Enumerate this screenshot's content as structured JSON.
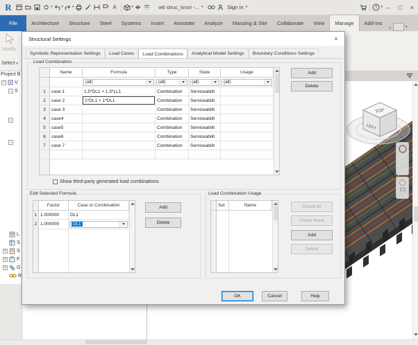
{
  "titlebar": {
    "document_title": "w6 struc_knsri -...",
    "sign_in_label": "Sign In"
  },
  "icons": {
    "minimize": "–",
    "maximize": "□",
    "close": "×",
    "overflow": "»",
    "caret": "▾",
    "expand_plus": "+",
    "collapse_minus": "−",
    "help_mark": "?"
  },
  "ribbon": {
    "tabs": [
      "File",
      "Architecture",
      "Structure",
      "Steel",
      "Systems",
      "Insert",
      "Annotate",
      "Analyze",
      "Massing & Site",
      "Collaborate",
      "View",
      "Manage",
      "Add-Ins"
    ],
    "active_tab": "Manage",
    "modify_label": "Modify",
    "select_label": "Select"
  },
  "project_browser": {
    "title": "Project B",
    "items": [
      {
        "label": "V"
      },
      {
        "label": "S"
      },
      {
        "label": ""
      },
      {
        "label": ""
      },
      {
        "label": "L"
      },
      {
        "label": "S"
      },
      {
        "label": "S"
      },
      {
        "label": "F"
      },
      {
        "label": "G"
      },
      {
        "label": "R"
      }
    ]
  },
  "view": {
    "cube_top": "TOP",
    "cube_left": "LEFT"
  },
  "dialog": {
    "title": "Structural Settings",
    "tabs": [
      "Symbolic Representation Settings",
      "Load Cases",
      "Load Combinations",
      "Analytical Model Settings",
      "Boundary Conditions Settings"
    ],
    "active_tab": "Load Combinations",
    "load_combination": {
      "group_label": "Load Combination",
      "columns": [
        "Name",
        "Formula",
        "Type",
        "State",
        "Usage"
      ],
      "filter_value": "(all)",
      "rows": [
        {
          "num": "1",
          "name": "case 1",
          "formula": "1.5*DL1 + 1.5*LL1",
          "type": "Combination",
          "state": "Serviceabilit",
          "usage": ""
        },
        {
          "num": "2",
          "name": "case 2",
          "formula": "1*DL1 + 1*DL1",
          "type": "Combination",
          "state": "Serviceabilit",
          "usage": ""
        },
        {
          "num": "3",
          "name": "case 3",
          "formula": "",
          "type": "Combination",
          "state": "Serviceabilit",
          "usage": ""
        },
        {
          "num": "4",
          "name": "case4",
          "formula": "",
          "type": "Combination",
          "state": "Serviceabilit",
          "usage": ""
        },
        {
          "num": "5",
          "name": "case5",
          "formula": "",
          "type": "Combination",
          "state": "Serviceabilit",
          "usage": ""
        },
        {
          "num": "6",
          "name": "case6",
          "formula": "",
          "type": "Combination",
          "state": "Serviceabilit",
          "usage": ""
        },
        {
          "num": "7",
          "name": "case 7",
          "formula": "",
          "type": "Combination",
          "state": "Serviceabilit",
          "usage": ""
        }
      ],
      "add_label": "Add",
      "delete_label": "Delete",
      "checkbox_label": "Show third-party generated load combinations"
    },
    "edit_formula": {
      "group_label": "Edit Selected Formula",
      "columns": [
        "Factor",
        "Case or Combination"
      ],
      "rows": [
        {
          "num": "1",
          "factor": "1.000000",
          "case_name": "DL1"
        },
        {
          "num": "2",
          "factor": "1.000000",
          "case_name": "DL1"
        }
      ],
      "add_label": "Add",
      "delete_label": "Delete"
    },
    "usage": {
      "group_label": "Load Combination Usage",
      "columns": [
        "Set",
        "Name"
      ],
      "check_all_label": "Check All",
      "check_none_label": "Check None",
      "add_label": "Add",
      "delete_label": "Delete"
    },
    "footer": {
      "ok_label": "OK",
      "cancel_label": "Cancel",
      "help_label": "Help"
    }
  },
  "colors": {
    "file_tab_blue": "#2d6cb4",
    "selection_blue": "#0078d7",
    "slab_gray": "#4d4d4d",
    "beam_orange": "#c4702a",
    "beam_red": "#b13326",
    "beam_green": "#47823a"
  }
}
